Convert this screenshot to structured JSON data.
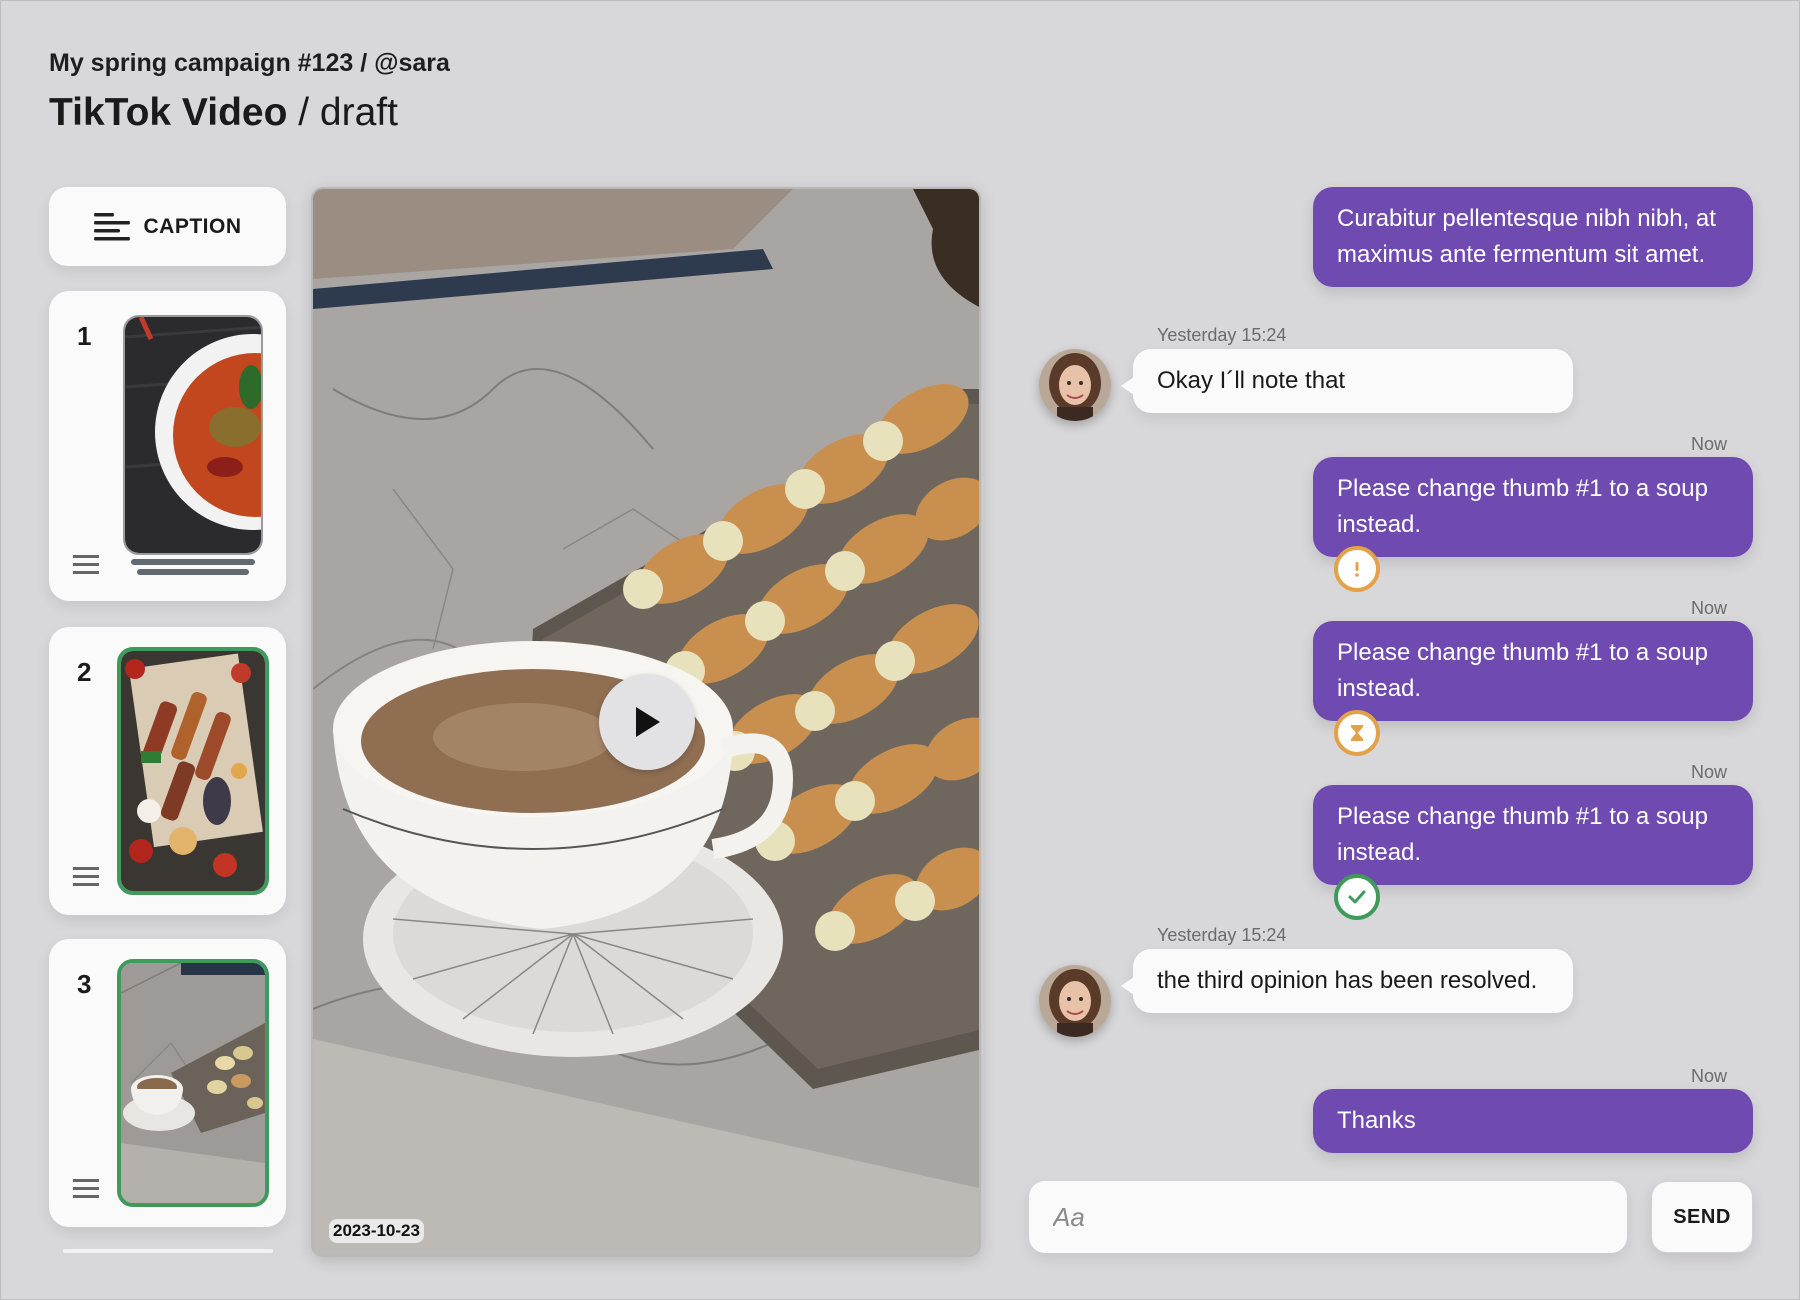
{
  "header": {
    "breadcrumb": "My spring campaign #123 / @sara",
    "title_main": "TikTok Video",
    "title_suffix": " / draft"
  },
  "sidebar": {
    "caption_label": "CAPTION",
    "thumbs": [
      {
        "number": "1",
        "selected": false
      },
      {
        "number": "2",
        "selected": true
      },
      {
        "number": "3",
        "selected": true
      }
    ]
  },
  "video": {
    "date": "2023-10-23"
  },
  "chat": {
    "messages": [
      {
        "direction": "out",
        "text": "Curabitur pellentesque nibh nibh, at maximus ante fermentum sit amet."
      },
      {
        "direction": "in",
        "time": "Yesterday 15:24",
        "text": "Okay I´ll note that"
      },
      {
        "direction": "out",
        "time": "Now",
        "text": "Please change thumb #1 to a soup instead.",
        "status": "warning-icon"
      },
      {
        "direction": "out",
        "time": "Now",
        "text": "Please change thumb #1 to a soup instead.",
        "status": "hourglass-icon"
      },
      {
        "direction": "out",
        "time": "Now",
        "text": "Please change thumb #1 to a soup instead.",
        "status": "check-icon"
      },
      {
        "direction": "in",
        "time": "Yesterday 15:24",
        "text": "the third opinion has been resolved."
      },
      {
        "direction": "out",
        "time": "Now",
        "text": "Thanks"
      }
    ],
    "input_placeholder": "Aa",
    "send_label": "SEND"
  },
  "colors": {
    "accent_purple": "#6f4ab0",
    "selected_green": "#3f9a5c",
    "warning_orange": "#e3a24a",
    "background": "#d8d7da"
  }
}
